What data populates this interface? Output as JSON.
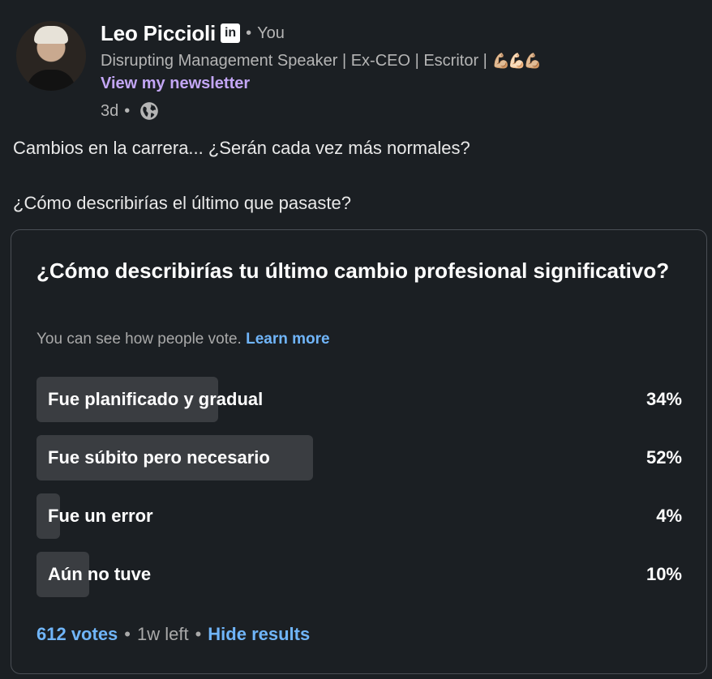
{
  "author": {
    "name": "Leo Piccioli",
    "badge": "in",
    "relation": "You",
    "headline": "Disrupting Management Speaker | Ex-CEO | Escritor |",
    "headline_emoji": "💪🏼💪🏻💪🏼",
    "newsletter_link": "View my newsletter",
    "age": "3d",
    "visibility_icon": "globe-icon"
  },
  "post": {
    "line1": "Cambios en la carrera... ¿Serán cada vez más normales?",
    "line2": "¿Cómo describirías el último que pasaste?"
  },
  "poll": {
    "question": "¿Cómo describirías tu último cambio profesional significativo?",
    "visibility_note": "You can see how people vote.",
    "learn_more": "Learn more",
    "options": [
      {
        "label": "Fue planificado y gradual",
        "percent": "34%",
        "share": 0.34
      },
      {
        "label": "Fue súbito pero necesario",
        "percent": "52%",
        "share": 0.52
      },
      {
        "label": "Fue un error",
        "percent": "4%",
        "share": 0.04
      },
      {
        "label": "Aún no tuve",
        "percent": "10%",
        "share": 0.1
      }
    ],
    "votes": "612 votes",
    "time_left": "1w left",
    "hide_results": "Hide results"
  },
  "colors": {
    "background": "#1b1f23",
    "link_blue": "#70b5f9",
    "newsletter_purple": "#c3a6f5",
    "bar_fill": "#3a3d41"
  }
}
